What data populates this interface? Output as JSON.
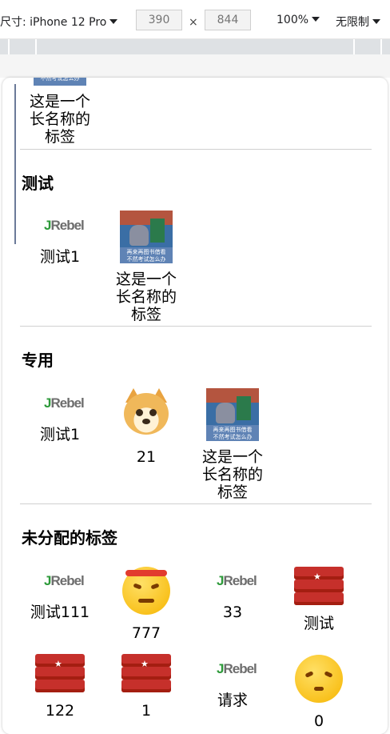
{
  "toolbar": {
    "device_label": "尺寸: iPhone 12 Pro",
    "width": "390",
    "times": "×",
    "height": "844",
    "zoom": "100%",
    "throttle": "无限制"
  },
  "meme_caption_top": "再来再图书借看",
  "meme_caption_bottom": "不然考试怎么办",
  "jrebel_text": "Rebel",
  "jrebel_j": "J",
  "top_partial_item": {
    "label": "这是一个长名称的标签",
    "icon": "meme-picture"
  },
  "sections": [
    {
      "title": "测试",
      "items": [
        {
          "label": "测试1",
          "icon": "jrebel-logo"
        },
        {
          "label": "这是一个长名称的标签",
          "icon": "meme-picture"
        }
      ]
    },
    {
      "title": "专用",
      "items": [
        {
          "label": "测试1",
          "icon": "jrebel-logo"
        },
        {
          "label": "21",
          "icon": "doge-emoji"
        },
        {
          "label": "这是一个长名称的标签",
          "icon": "meme-picture"
        }
      ]
    },
    {
      "title": "未分配的标签",
      "items": [
        {
          "label": "测试111",
          "icon": "jrebel-logo"
        },
        {
          "label": "777",
          "icon": "angry-emoji"
        },
        {
          "label": "33",
          "icon": "jrebel-logo"
        },
        {
          "label": "测试",
          "icon": "redis-logo"
        },
        {
          "label": "122",
          "icon": "redis-logo"
        },
        {
          "label": "1",
          "icon": "redis-logo"
        },
        {
          "label": "请求",
          "icon": "jrebel-logo"
        },
        {
          "label": "0",
          "icon": "annoyed-emoji"
        }
      ]
    }
  ],
  "colors": {
    "section_divider": "#d0d0d0",
    "redis_red": "#c6302b",
    "jrebel_green": "#2d9a3a"
  }
}
